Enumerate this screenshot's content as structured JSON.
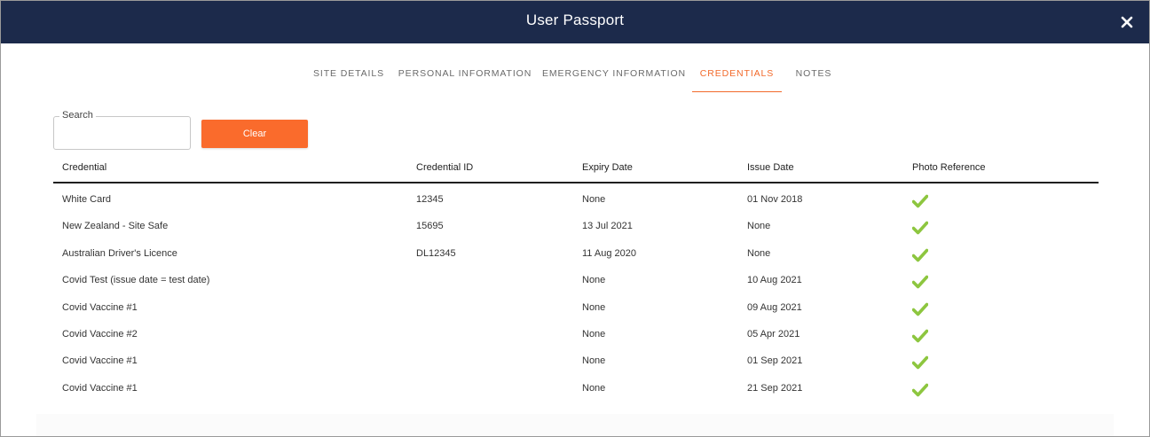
{
  "window": {
    "title": "User Passport"
  },
  "tabs": [
    {
      "label": "SITE DETAILS",
      "active": false
    },
    {
      "label": "PERSONAL INFORMATION",
      "active": false
    },
    {
      "label": "EMERGENCY INFORMATION",
      "active": false
    },
    {
      "label": "CREDENTIALS",
      "active": true
    },
    {
      "label": "NOTES",
      "active": false
    }
  ],
  "search": {
    "label": "Search",
    "value": "",
    "clear_label": "Clear"
  },
  "table": {
    "columns": [
      "Credential",
      "Credential ID",
      "Expiry Date",
      "Issue Date",
      "Photo Reference"
    ],
    "rows": [
      {
        "credential": "White Card",
        "id": "12345",
        "expiry": "None",
        "issue": "01 Nov 2018",
        "photo": "check-icon"
      },
      {
        "credential": "New Zealand - Site Safe",
        "id": "15695",
        "expiry": "13 Jul 2021",
        "issue": "None",
        "photo": "check-icon"
      },
      {
        "credential": "Australian Driver's Licence",
        "id": "DL12345",
        "expiry": "11 Aug 2020",
        "issue": "None",
        "photo": "check-icon"
      },
      {
        "credential": "Covid Test (issue date = test date)",
        "id": "",
        "expiry": "None",
        "issue": "10 Aug 2021",
        "photo": "check-icon"
      },
      {
        "credential": "Covid Vaccine #1",
        "id": "",
        "expiry": "None",
        "issue": "09 Aug 2021",
        "photo": "check-icon"
      },
      {
        "credential": "Covid Vaccine #2",
        "id": "",
        "expiry": "None",
        "issue": "05 Apr 2021",
        "photo": "check-icon"
      },
      {
        "credential": "Covid Vaccine #1",
        "id": "",
        "expiry": "None",
        "issue": "01 Sep 2021",
        "photo": "check-icon"
      },
      {
        "credential": "Covid Vaccine #1",
        "id": "",
        "expiry": "None",
        "issue": "21 Sep 2021",
        "photo": "check-icon"
      }
    ]
  },
  "colors": {
    "header": "#1c2a4b",
    "accent": "#f26a2b",
    "check": "#8dc63f"
  }
}
